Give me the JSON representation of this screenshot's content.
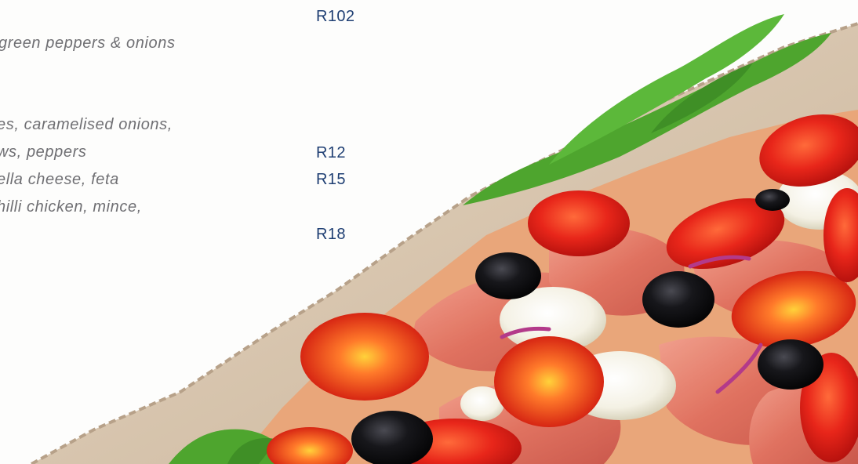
{
  "menu": {
    "lines": [
      "green peppers & onions",
      "es, caramelised onions,",
      "ws, peppers",
      "ella cheese, feta",
      "hilli chicken, mince,"
    ],
    "prices": [
      "R102",
      "R12",
      "R15",
      "R18"
    ]
  },
  "photo": {
    "subject": "pizza-photo"
  }
}
